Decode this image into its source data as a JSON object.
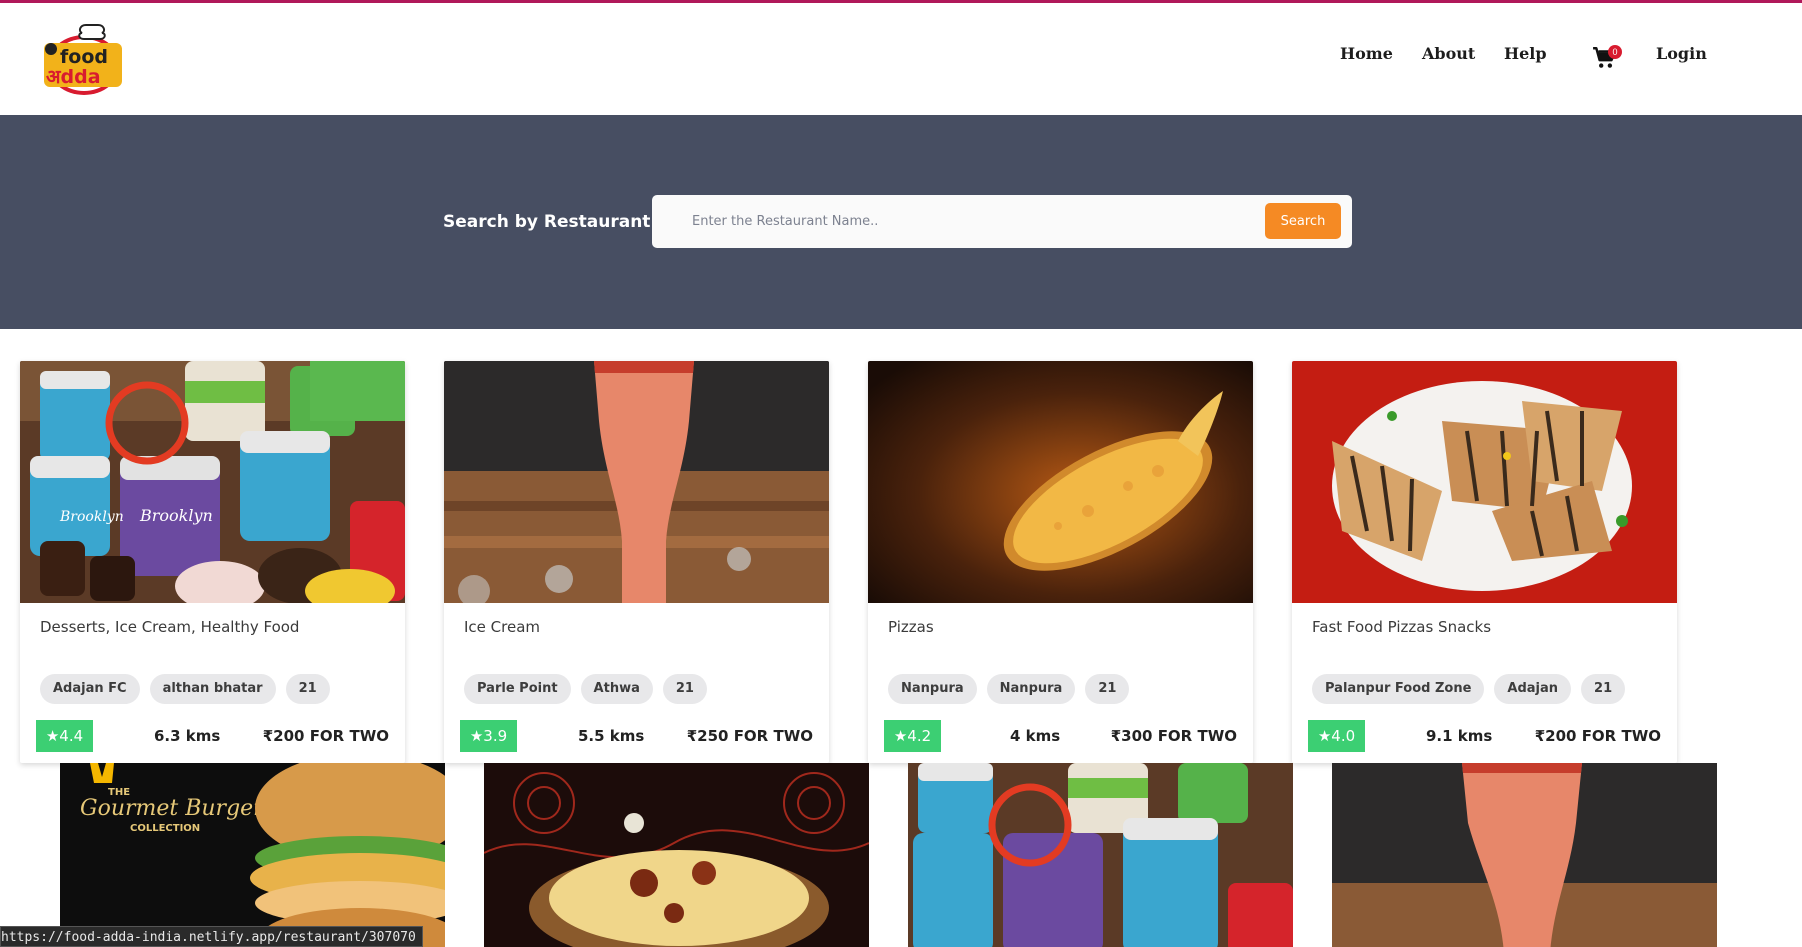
{
  "header": {
    "logo_top": "food",
    "logo_bottom": "अdda",
    "nav": [
      {
        "label": "Home"
      },
      {
        "label": "About"
      },
      {
        "label": "Help"
      }
    ],
    "cart_count": "0",
    "login_label": "Login"
  },
  "search": {
    "label": "Search by Restaurant",
    "placeholder": "Enter the Restaurant Name..",
    "button_label": "Search"
  },
  "restaurants": [
    {
      "cuisine": "Desserts, Ice Cream, Healthy Food",
      "tags": [
        "Adajan FC",
        "althan bhatar",
        "21"
      ],
      "rating": "★4.4",
      "distance": "6.3 kms",
      "price": "₹200 FOR TWO"
    },
    {
      "cuisine": "Ice Cream",
      "tags": [
        "Parle Point",
        "Athwa",
        "21"
      ],
      "rating": "★3.9",
      "distance": "5.5 kms",
      "price": "₹250 FOR TWO"
    },
    {
      "cuisine": "Pizzas",
      "tags": [
        "Nanpura",
        "Nanpura",
        "21"
      ],
      "rating": "★4.2",
      "distance": "4 kms",
      "price": "₹300 FOR TWO"
    },
    {
      "cuisine": "Fast Food Pizzas Snacks",
      "tags": [
        "Palanpur Food Zone",
        "Adajan",
        "21"
      ],
      "rating": "★4.0",
      "distance": "9.1 kms",
      "price": "₹200 FOR TWO"
    }
  ],
  "second_row_images": {
    "burger_line1": "THE",
    "burger_line2": "Gourmet Burger",
    "burger_line3": "COLLECTION"
  },
  "status_url": "https://food-adda-india.netlify.app/restaurant/307070",
  "colors": {
    "top_strip": "#b0185a",
    "search_band": "#474e62",
    "search_button": "#f58a24",
    "rating_badge": "#3ccf73",
    "cart_badge": "#d81b2f"
  }
}
